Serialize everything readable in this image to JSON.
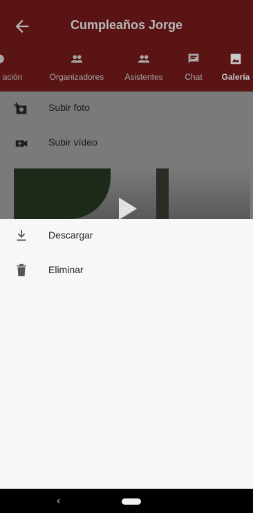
{
  "app_bar": {
    "title": "Cumpleaños Jorge"
  },
  "tabs": [
    {
      "label": "ación",
      "icon": "partial-icon"
    },
    {
      "label": "Organizadores",
      "icon": "group-icon"
    },
    {
      "label": "Asistentes",
      "icon": "group-icon"
    },
    {
      "label": "Chat",
      "icon": "chat-icon"
    },
    {
      "label": "Galería",
      "icon": "photo-library-icon"
    }
  ],
  "list": {
    "items": [
      {
        "label": "Subir foto",
        "icon": "add-photo-icon"
      },
      {
        "label": "Subir vídeo",
        "icon": "video-call-icon"
      }
    ]
  },
  "sheet": {
    "items": [
      {
        "label": "Descargar",
        "icon": "download-icon"
      },
      {
        "label": "Eliminar",
        "icon": "trash-icon"
      }
    ]
  },
  "colors": {
    "scrim": "#7a7a7a",
    "appbar": "#5a1414",
    "sheet": "#f7f7f7",
    "navbar": "#000000"
  }
}
